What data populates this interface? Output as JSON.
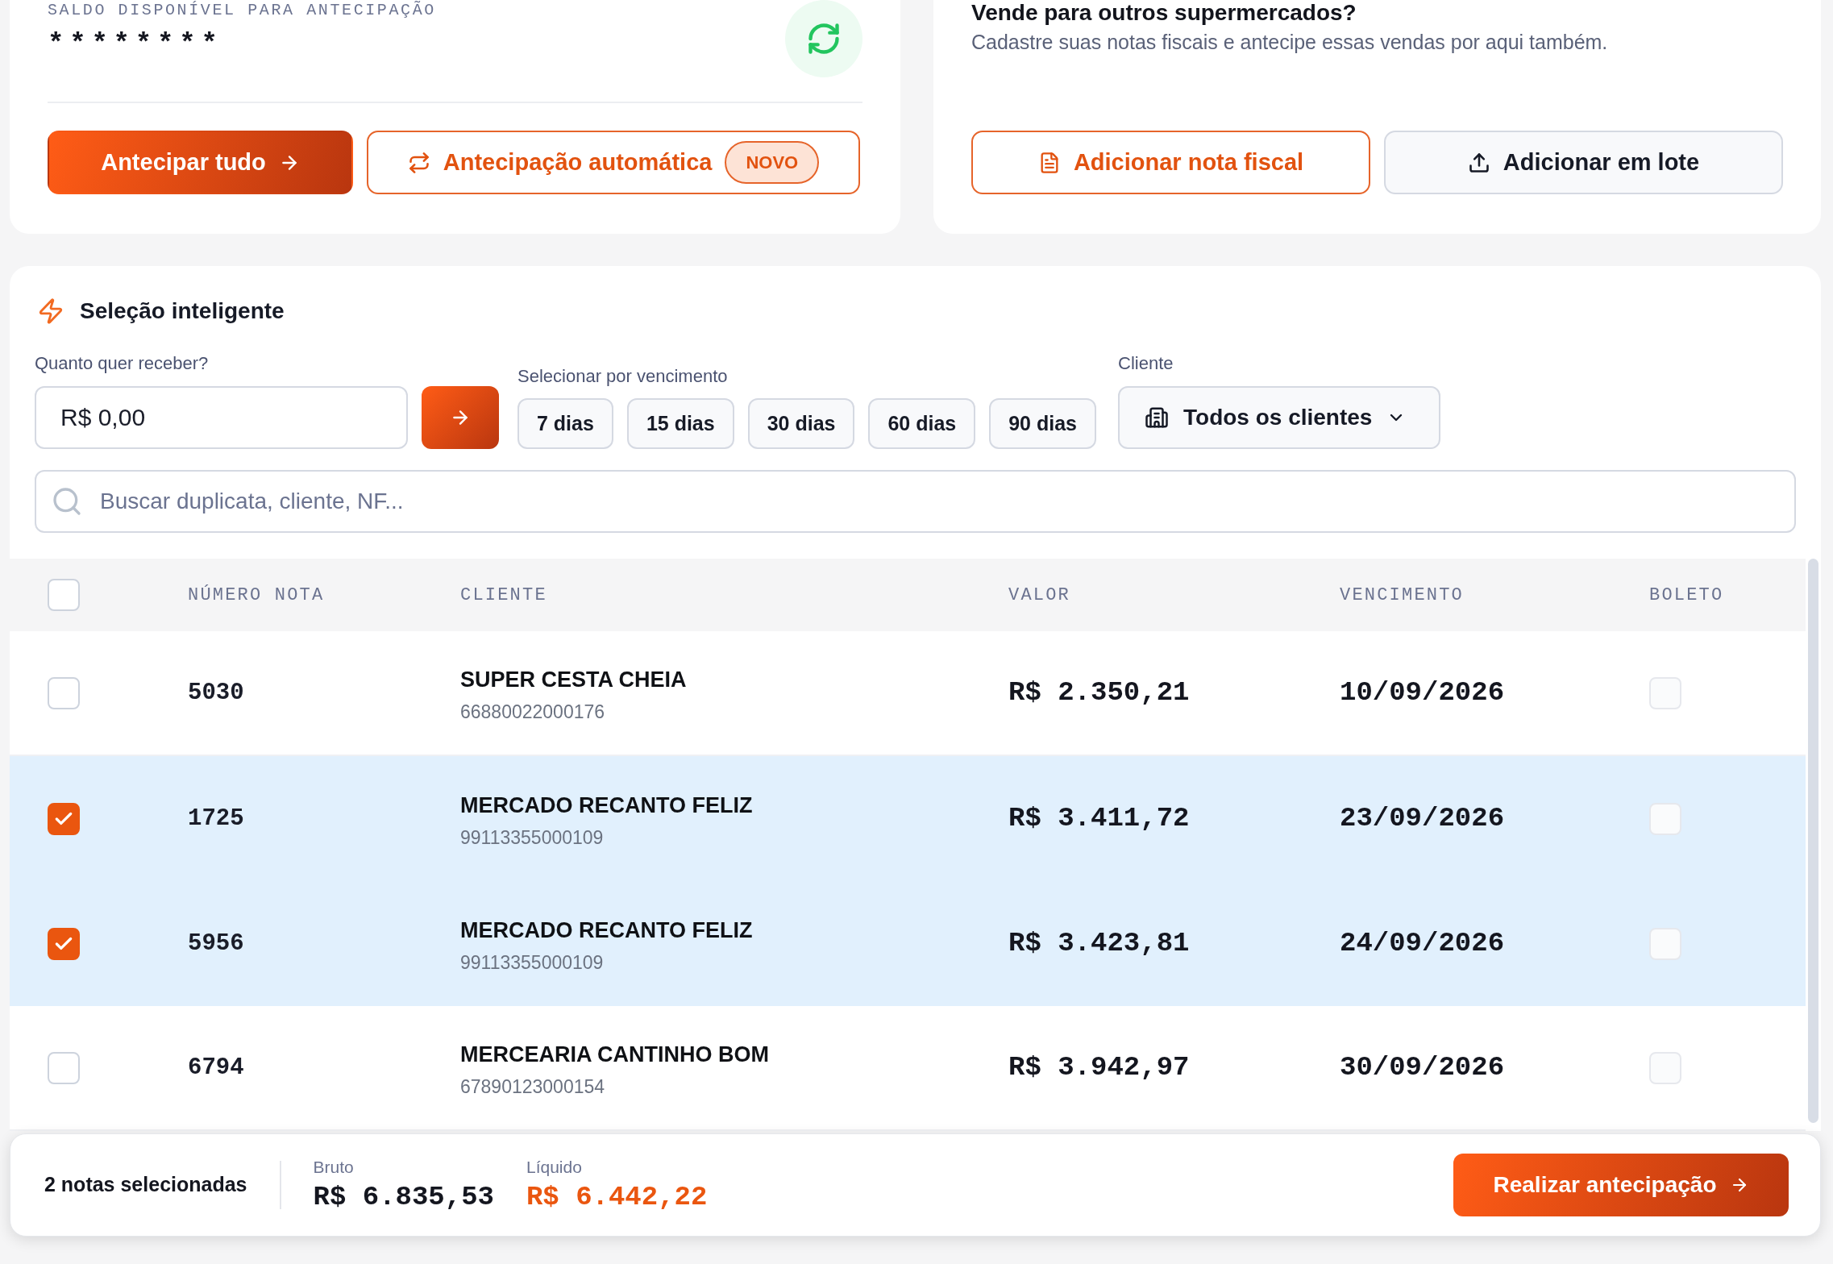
{
  "balance_card": {
    "label": "SALDO DISPONÍVEL PARA ANTECIPAÇÃO",
    "value": "********",
    "buttons": [
      {
        "kind": "primary",
        "label": "Antecipar tudo"
      },
      {
        "kind": "outline",
        "label": "Antecipação automática",
        "badge": "NOVO"
      }
    ]
  },
  "invoice_card": {
    "title": "Vende para outros supermercados?",
    "text": "Cadastre suas notas fiscais e antecipe essas vendas por aqui também.",
    "buttons": [
      {
        "kind": "outline",
        "label": "Adicionar nota fiscal"
      },
      {
        "kind": "secondary",
        "label": "Adicionar em lote"
      }
    ]
  },
  "smart_selection": {
    "title": "Seleção inteligente",
    "amount": {
      "label": "Quanto quer receber?",
      "value": "R$ 0,00"
    },
    "due": {
      "label": "Selecionar por vencimento",
      "options": [
        {
          "label": "7 dias",
          "selected": false
        },
        {
          "label": "15 dias",
          "selected": false
        },
        {
          "label": "30 dias",
          "selected": false
        },
        {
          "label": "60 dias",
          "selected": false
        },
        {
          "label": "90 dias",
          "selected": false
        }
      ]
    },
    "client": {
      "label": "Cliente",
      "value": "Todos os clientes"
    },
    "search": {
      "placeholder": "Buscar duplicata, cliente, NF..."
    }
  },
  "table": {
    "select_all": false,
    "columns": [
      "NÚMERO NOTA",
      "CLIENTE",
      "VALOR",
      "VENCIMENTO",
      "BOLETO"
    ],
    "rows": [
      {
        "number": "5030",
        "client": "SUPER CESTA CHEIA",
        "tax_id": "66880022000176",
        "value": "R$ 2.350,21",
        "due": "10/09/2026",
        "selected": false,
        "boleto": false
      },
      {
        "number": "1725",
        "client": "MERCADO RECANTO FELIZ",
        "tax_id": "99113355000109",
        "value": "R$ 3.411,72",
        "due": "23/09/2026",
        "selected": true,
        "boleto": false
      },
      {
        "number": "5956",
        "client": "MERCADO RECANTO FELIZ",
        "tax_id": "99113355000109",
        "value": "R$ 3.423,81",
        "due": "24/09/2026",
        "selected": true,
        "boleto": false
      },
      {
        "number": "6794",
        "client": "MERCEARIA CANTINHO BOM",
        "tax_id": "67890123000154",
        "value": "R$ 3.942,97",
        "due": "30/09/2026",
        "selected": false,
        "boleto": false
      }
    ]
  },
  "footer": {
    "count": "2 notas selecionadas",
    "gross": {
      "label": "Bruto",
      "value": "R$ 6.835,53"
    },
    "net": {
      "label": "Líquido",
      "value": "R$ 6.442,22"
    },
    "button": "Realizar antecipação"
  }
}
